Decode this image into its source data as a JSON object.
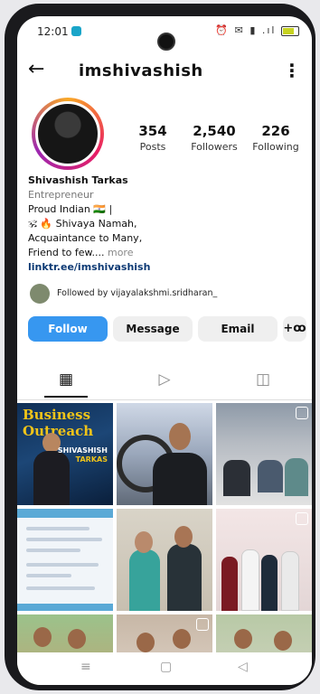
{
  "status_bar": {
    "time": "12:01",
    "right_icons": "⏰ ✉ ▮ .ıl"
  },
  "header": {
    "back_icon": "←",
    "username": "imshivashish",
    "menu_icon": "⋮"
  },
  "profile": {
    "stats": [
      {
        "value": "354",
        "label": "Posts"
      },
      {
        "value": "2,540",
        "label": "Followers"
      },
      {
        "value": "226",
        "label": "Following"
      }
    ],
    "bio": {
      "name": "Shivashish Tarkas",
      "category": "Entrepreneur",
      "line1": "Proud Indian 🇮🇳 |",
      "line2": "🕉 🔥 Shivaya Namah,",
      "line3": "Acquaintance to Many,",
      "line4": "Friend to few....",
      "more": "more",
      "link": "linktr.ee/imshivashish"
    },
    "followed_by": "Followed by vijayalakshmi.sridharan_"
  },
  "actions": {
    "follow": "Follow",
    "message": "Message",
    "email": "Email",
    "add_person_icon": "+ꝏ"
  },
  "tabs": {
    "grid_icon": "▦",
    "reels_icon": "▷",
    "tagged_icon": "◫"
  },
  "posts": {
    "post1_title": "Business Outreach",
    "post1_name1": "SHIVASHISH",
    "post1_name2": "TARKAS"
  },
  "nav": {
    "menu_icon": "≡",
    "home_icon": "▢",
    "back_icon": "◁"
  }
}
